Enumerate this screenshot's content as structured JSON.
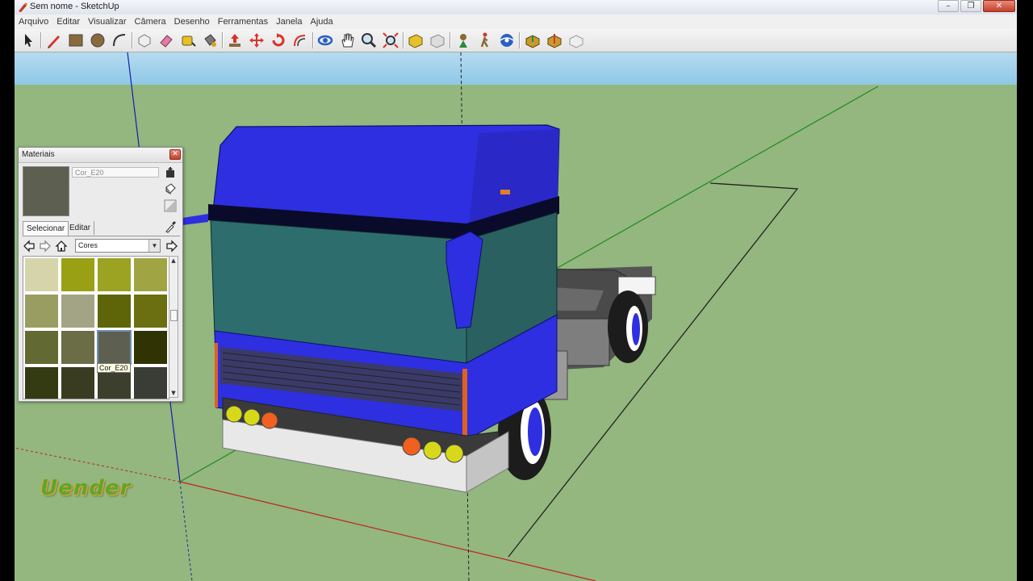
{
  "window": {
    "title": "Sem nome - SketchUp",
    "controls": {
      "minimize": "–",
      "maximize": "❐",
      "close": "✕"
    }
  },
  "menu": [
    "Arquivo",
    "Editar",
    "Visualizar",
    "Câmera",
    "Desenho",
    "Ferramentas",
    "Janela",
    "Ajuda"
  ],
  "toolbar": {
    "tools": [
      "select-tool-icon",
      "pencil-line-icon",
      "rectangle-icon",
      "circle-icon",
      "arc-icon",
      "make-component-icon",
      "eraser-icon",
      "tape-measure-icon",
      "paint-bucket-icon",
      "push-pull-icon",
      "move-icon",
      "rotate-icon",
      "offset-icon",
      "orbit-icon",
      "pan-icon",
      "zoom-icon",
      "zoom-extents-icon",
      "previous-view-icon",
      "next-view-icon",
      "position-camera-icon",
      "walk-icon",
      "look-around-icon",
      "get-models-icon",
      "share-model-icon",
      "extension-warehouse-icon"
    ]
  },
  "materials_panel": {
    "title": "Materiais",
    "close": "✕",
    "material_name": "Cor_E20",
    "preview_color": "#5d6050",
    "tabs": {
      "select": "Selecionar",
      "edit": "Editar"
    },
    "library": "Cores",
    "swatches": [
      "#d6d4aa",
      "#9aa014",
      "#9ca221",
      "#a1a443",
      "#9a9d62",
      "#a3a386",
      "#5e6408",
      "#6b6f11",
      "#636932",
      "#6a6d46",
      "#5d6050",
      "#303404",
      "#343a12",
      "#3a3c22",
      "#3c3f2c",
      "#3a3d36"
    ],
    "selected_index": 10,
    "tooltip": "Cor_E20"
  },
  "colors": {
    "sky": "#9ccfe8",
    "ground": "#93b77e",
    "truck_body": "#2e2fe0",
    "cab_panel": "#2e6d6d"
  },
  "watermark": "Uender"
}
